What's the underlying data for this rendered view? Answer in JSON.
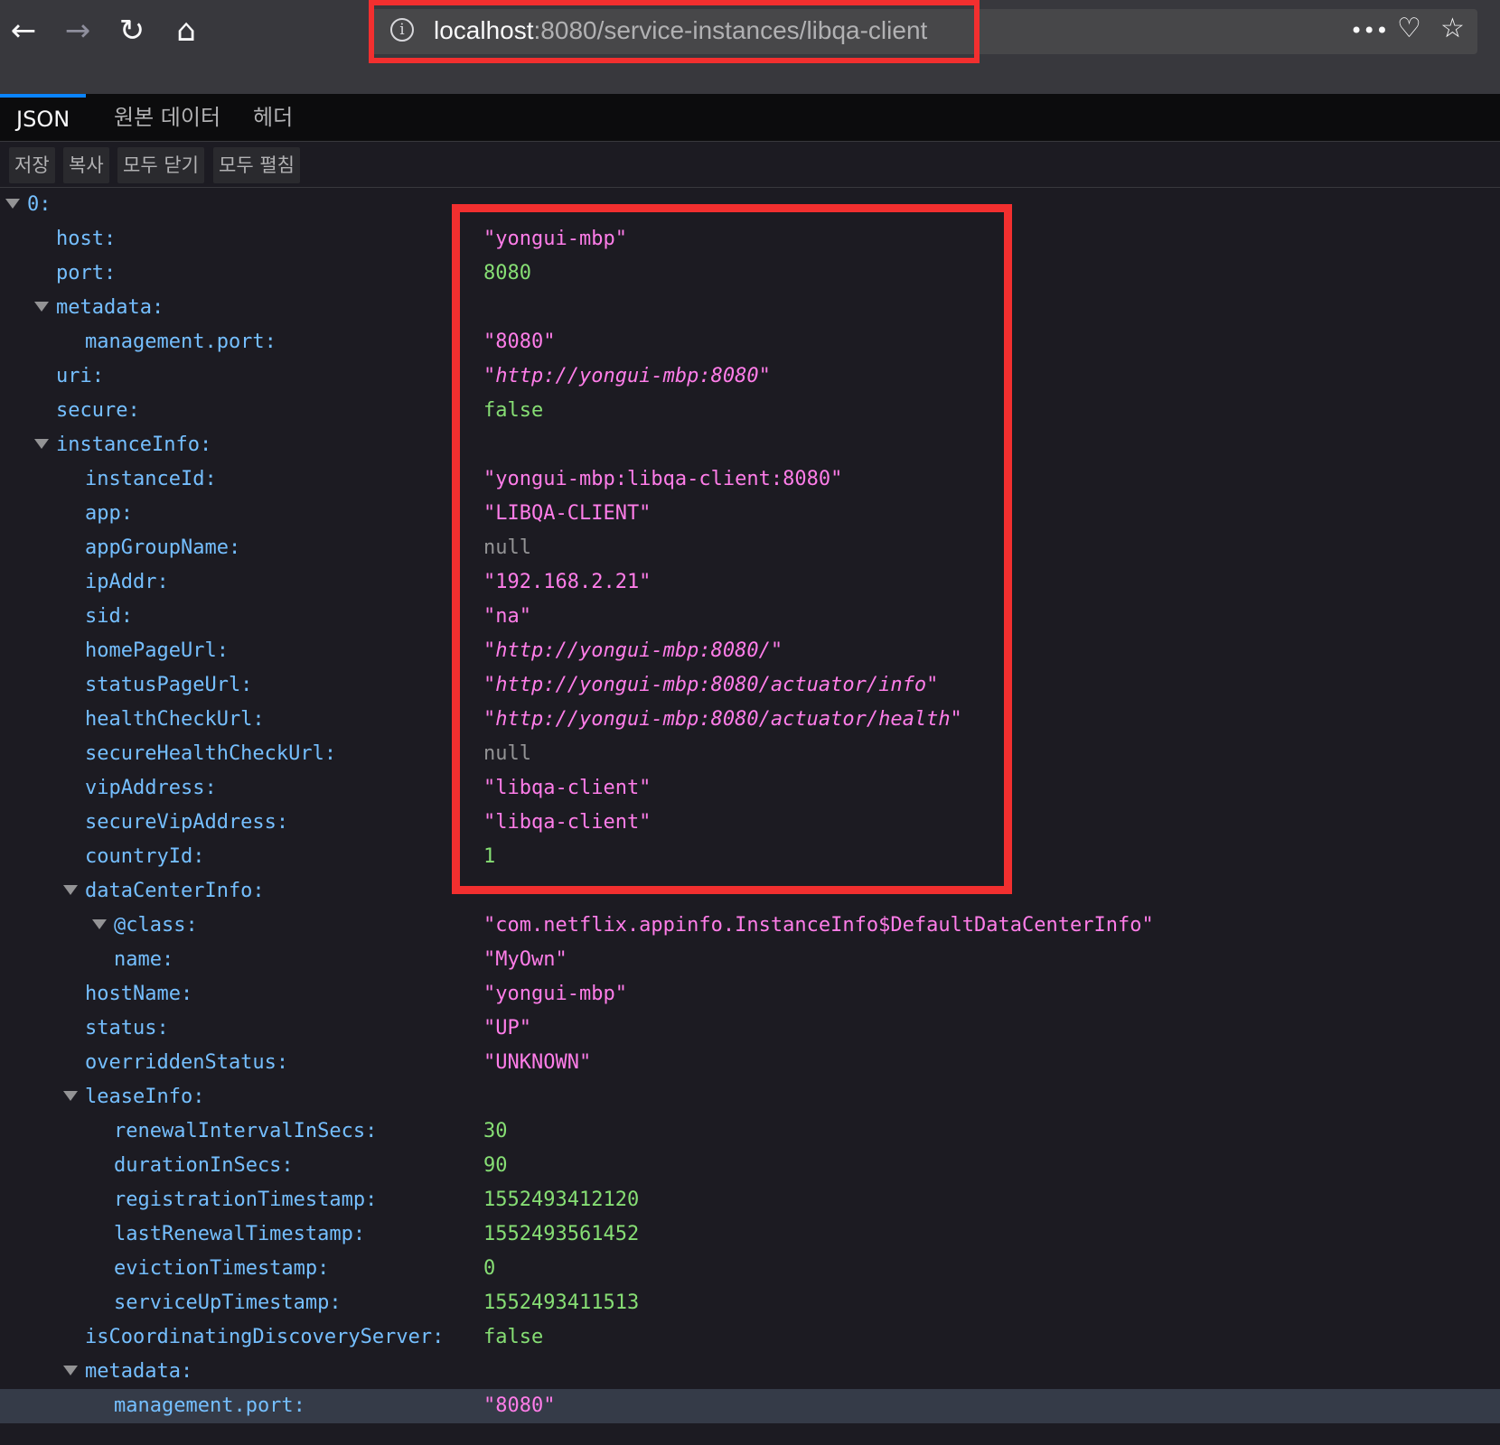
{
  "browser": {
    "url_host": "localhost",
    "url_path": ":8080/service-instances/libqa-client",
    "back": "←",
    "forward": "→",
    "reload": "↻",
    "home": "⌂",
    "more": "•••",
    "pocket": "♡",
    "bookmark": "☆",
    "icons": {
      "info": "info-icon",
      "back": "back-arrow-icon",
      "forward": "forward-arrow-icon",
      "reload": "reload-icon",
      "home": "home-icon",
      "more": "more-icon",
      "pocket": "pocket-icon",
      "bookmark": "star-icon"
    }
  },
  "viewer": {
    "tabs": [
      {
        "label": "JSON",
        "active": true
      },
      {
        "label": "원본 데이터",
        "active": false
      },
      {
        "label": "헤더",
        "active": false
      }
    ],
    "toolbar": [
      {
        "label": "저장"
      },
      {
        "label": "복사"
      },
      {
        "label": "모두 닫기"
      },
      {
        "label": "모두 펼침"
      }
    ]
  },
  "tree": [
    {
      "key": "0:",
      "value": "",
      "type": "none",
      "depth": 0,
      "twisty": true
    },
    {
      "key": "host:",
      "value": "\"yongui-mbp\"",
      "type": "string",
      "depth": 1
    },
    {
      "key": "port:",
      "value": "8080",
      "type": "number",
      "depth": 1
    },
    {
      "key": "metadata:",
      "value": "",
      "type": "none",
      "depth": 1,
      "twisty": true
    },
    {
      "key": "management.port:",
      "value": "\"8080\"",
      "type": "string",
      "depth": 2
    },
    {
      "key": "uri:",
      "value": "\"http://yongui-mbp:8080\"",
      "type": "url",
      "depth": 1
    },
    {
      "key": "secure:",
      "value": "false",
      "type": "bool",
      "depth": 1
    },
    {
      "key": "instanceInfo:",
      "value": "",
      "type": "none",
      "depth": 1,
      "twisty": true
    },
    {
      "key": "instanceId:",
      "value": "\"yongui-mbp:libqa-client:8080\"",
      "type": "string",
      "depth": 2
    },
    {
      "key": "app:",
      "value": "\"LIBQA-CLIENT\"",
      "type": "string",
      "depth": 2
    },
    {
      "key": "appGroupName:",
      "value": "null",
      "type": "null",
      "depth": 2
    },
    {
      "key": "ipAddr:",
      "value": "\"192.168.2.21\"",
      "type": "string",
      "depth": 2
    },
    {
      "key": "sid:",
      "value": "\"na\"",
      "type": "string",
      "depth": 2
    },
    {
      "key": "homePageUrl:",
      "value": "\"http://yongui-mbp:8080/\"",
      "type": "url",
      "depth": 2
    },
    {
      "key": "statusPageUrl:",
      "value": "\"http://yongui-mbp:8080/actuator/info\"",
      "type": "url",
      "depth": 2
    },
    {
      "key": "healthCheckUrl:",
      "value": "\"http://yongui-mbp:8080/actuator/health\"",
      "type": "url",
      "depth": 2
    },
    {
      "key": "secureHealthCheckUrl:",
      "value": "null",
      "type": "null",
      "depth": 2
    },
    {
      "key": "vipAddress:",
      "value": "\"libqa-client\"",
      "type": "string",
      "depth": 2
    },
    {
      "key": "secureVipAddress:",
      "value": "\"libqa-client\"",
      "type": "string",
      "depth": 2
    },
    {
      "key": "countryId:",
      "value": "1",
      "type": "number",
      "depth": 2
    },
    {
      "key": "dataCenterInfo:",
      "value": "",
      "type": "none",
      "depth": 2,
      "twisty": true
    },
    {
      "key": "@class:",
      "value": "\"com.netflix.appinfo.InstanceInfo$DefaultDataCenterInfo\"",
      "type": "string",
      "depth": 3,
      "twisty": true
    },
    {
      "key": "name:",
      "value": "\"MyOwn\"",
      "type": "string",
      "depth": 3
    },
    {
      "key": "hostName:",
      "value": "\"yongui-mbp\"",
      "type": "string",
      "depth": 2
    },
    {
      "key": "status:",
      "value": "\"UP\"",
      "type": "string",
      "depth": 2
    },
    {
      "key": "overriddenStatus:",
      "value": "\"UNKNOWN\"",
      "type": "string",
      "depth": 2
    },
    {
      "key": "leaseInfo:",
      "value": "",
      "type": "none",
      "depth": 2,
      "twisty": true
    },
    {
      "key": "renewalIntervalInSecs:",
      "value": "30",
      "type": "number",
      "depth": 3
    },
    {
      "key": "durationInSecs:",
      "value": "90",
      "type": "number",
      "depth": 3
    },
    {
      "key": "registrationTimestamp:",
      "value": "1552493412120",
      "type": "number",
      "depth": 3
    },
    {
      "key": "lastRenewalTimestamp:",
      "value": "1552493561452",
      "type": "number",
      "depth": 3
    },
    {
      "key": "evictionTimestamp:",
      "value": "0",
      "type": "number",
      "depth": 3
    },
    {
      "key": "serviceUpTimestamp:",
      "value": "1552493411513",
      "type": "number",
      "depth": 3
    },
    {
      "key": "isCoordinatingDiscoveryServer:",
      "value": "false",
      "type": "bool",
      "depth": 2
    },
    {
      "key": "metadata:",
      "value": "",
      "type": "none",
      "depth": 2,
      "twisty": true
    },
    {
      "key": "management.port:",
      "value": "\"8080\"",
      "type": "string",
      "depth": 3,
      "selected": true
    }
  ],
  "colors": {
    "key": "#75bfff",
    "string": "#ff7de9",
    "number": "#86de74",
    "null": "#939395",
    "highlight": "#f22f2f",
    "tab_accent": "#0a84ff"
  }
}
